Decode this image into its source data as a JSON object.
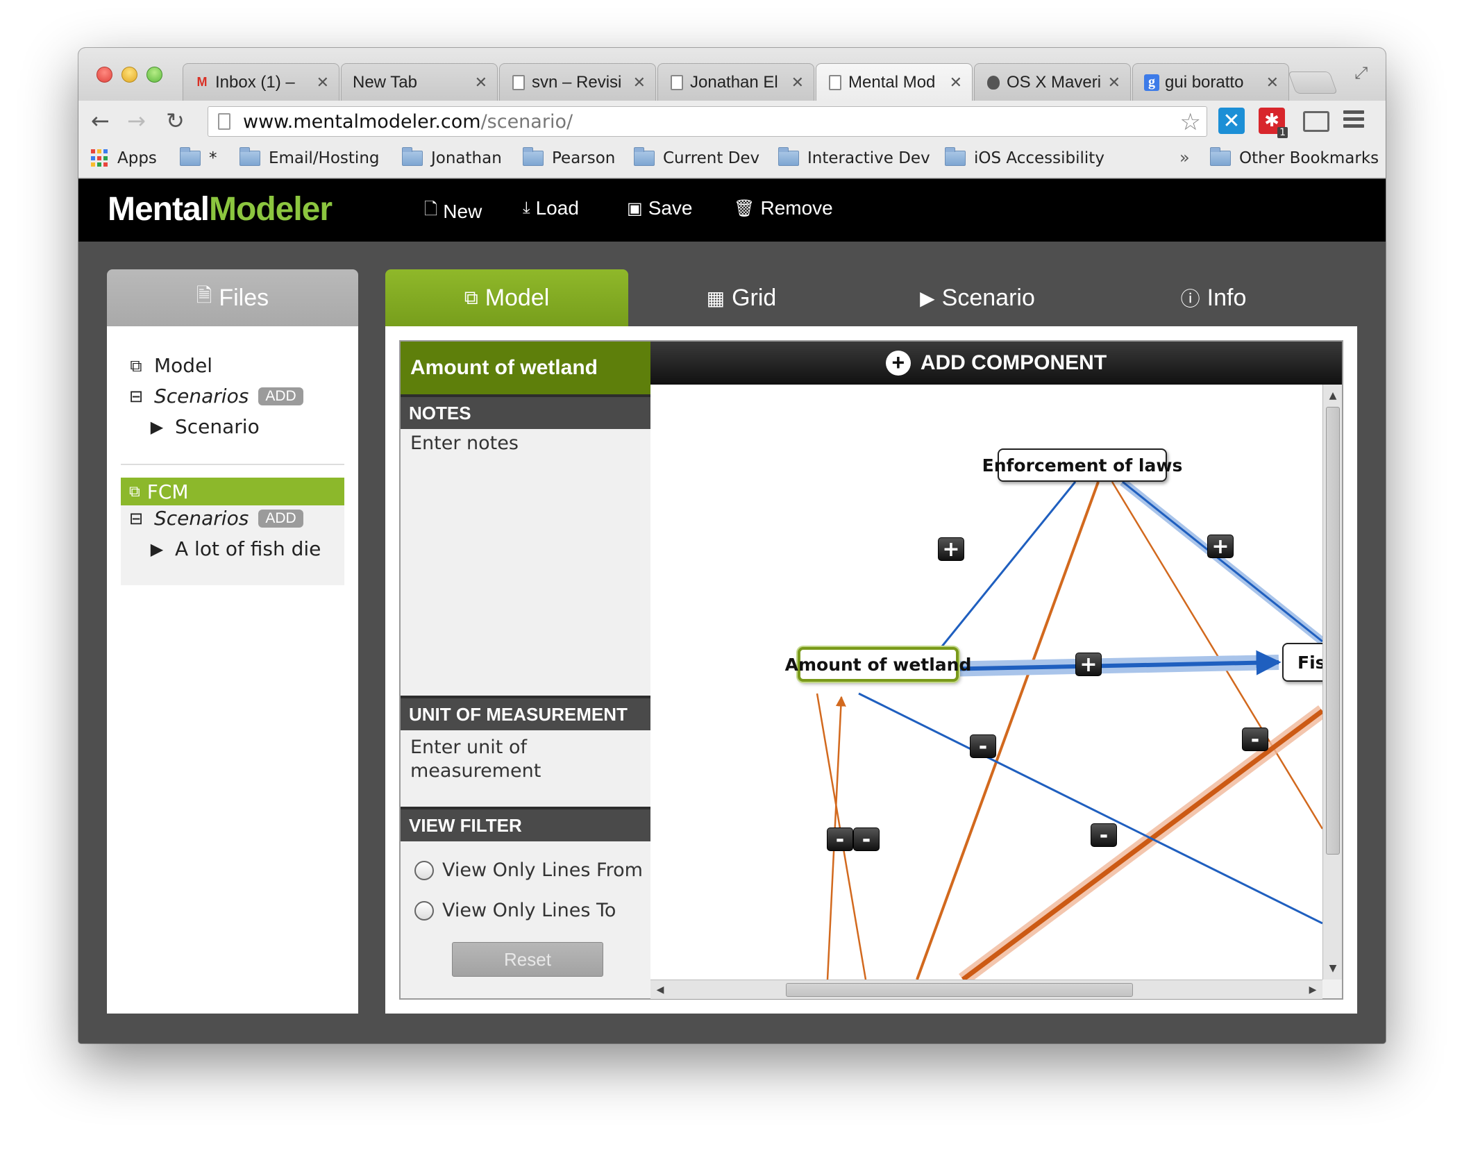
{
  "browser": {
    "tabs": [
      {
        "title": "Inbox (1) –",
        "icon": "gmail-icon"
      },
      {
        "title": "New Tab",
        "icon": ""
      },
      {
        "title": "svn – Revisi",
        "icon": "page-icon"
      },
      {
        "title": "Jonathan El",
        "icon": "page-icon"
      },
      {
        "title": "Mental Mod",
        "icon": "page-icon"
      },
      {
        "title": "OS X Maveri",
        "icon": "apple-icon"
      },
      {
        "title": "gui boratto",
        "icon": "google-icon"
      }
    ],
    "url_host": "www.mentalmodeler.com",
    "url_path": "/scenario/",
    "bookmarks": [
      {
        "label": "Apps"
      },
      {
        "label": "*"
      },
      {
        "label": "Email/Hosting"
      },
      {
        "label": "Jonathan"
      },
      {
        "label": "Pearson"
      },
      {
        "label": "Current Dev"
      },
      {
        "label": "Interactive Dev"
      },
      {
        "label": "iOS Accessibility"
      }
    ],
    "bookmarks_overflow": "»",
    "other_bookmarks": "Other Bookmarks",
    "extension_badge": "1"
  },
  "app": {
    "logo_part1": "Mental",
    "logo_part2": "Modeler",
    "logo_colors": {
      "part1": "#ffffff",
      "part2": "#8cc63f"
    },
    "menu": {
      "new": "New",
      "load": "Load",
      "save": "Save",
      "remove": "Remove"
    },
    "files_tab": "Files",
    "main_tabs": {
      "model": "Model",
      "grid": "Grid",
      "scenario": "Scenario",
      "info": "Info"
    },
    "accent_color": "#8cb82b"
  },
  "files": {
    "model_label": "Model",
    "scenarios_label": "Scenarios",
    "add_label": "ADD",
    "scenario_item": "Scenario",
    "fcm_label": "FCM",
    "fcm_scenarios_label": "Scenarios",
    "fcm_add_label": "ADD",
    "fcm_scenario_item": "A lot of fish die"
  },
  "component_panel": {
    "title": "Amount of wetland",
    "notes_heading": "NOTES",
    "notes_placeholder": "Enter notes",
    "unit_heading": "UNIT OF MEASUREMENT",
    "unit_placeholder": "Enter unit of measurement",
    "filter_heading": "VIEW FILTER",
    "filter_from": "View Only Lines From",
    "filter_to": "View Only Lines To",
    "reset_label": "Reset"
  },
  "canvas": {
    "add_component": "ADD COMPONENT",
    "nodes": {
      "enforcement": "Enforcement of laws",
      "wetland": "Amount of wetland",
      "fish": "Fis"
    },
    "edge_colors": {
      "positive": "#1f5fbf",
      "negative": "#d2691e"
    },
    "sign_plus": "+",
    "sign_minus": "-"
  }
}
